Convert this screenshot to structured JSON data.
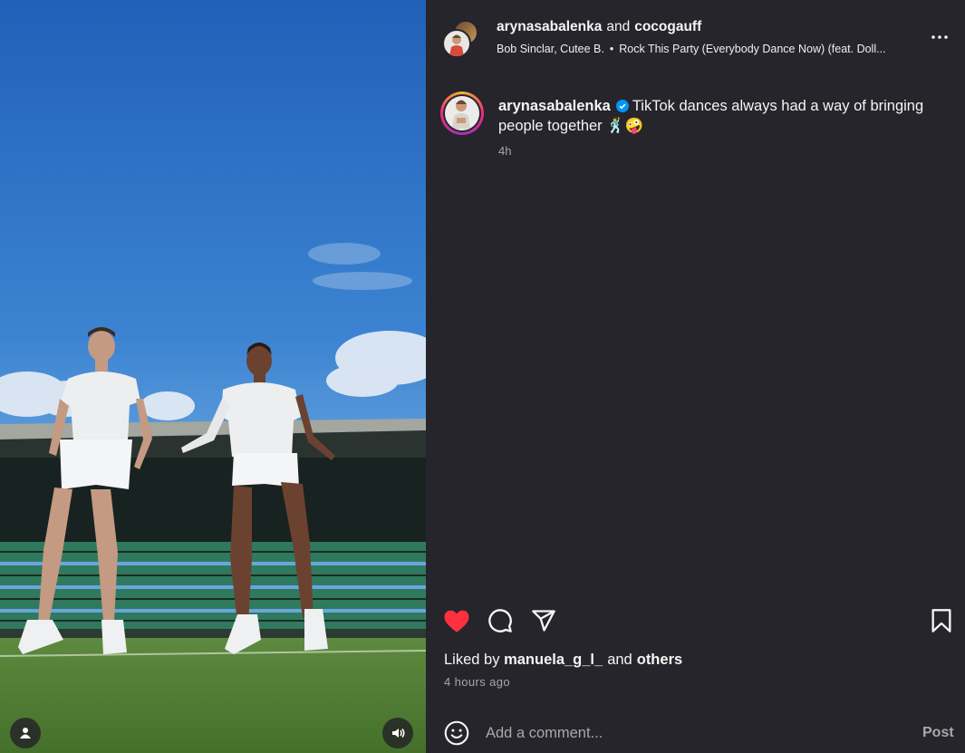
{
  "header": {
    "user_1": "arynasabalenka",
    "conjunction": "and",
    "user_2": "cocogauff",
    "audio_artist": "Bob Sinclar, Cutee B.",
    "audio_separator": "•",
    "audio_title": "Rock This Party (Everybody Dance Now) (feat. Doll..."
  },
  "caption": {
    "username": "arynasabalenka",
    "text": "TikTok dances always had a way of bringing people together 🕺🤪",
    "time": "4h"
  },
  "likes": {
    "prefix": "Liked by",
    "user": "manuela_g_l_",
    "mid": "and",
    "others": "others"
  },
  "post_time": "4 hours ago",
  "comment": {
    "placeholder": "Add a comment...",
    "post_label": "Post"
  },
  "colors": {
    "panel_bg": "#25252b",
    "like_red": "#ff3040",
    "verified_blue": "#0095f6",
    "muted_text": "#a8a8a8"
  },
  "icons": {
    "more": "more-horizontal-icon",
    "like": "heart-filled-icon",
    "comment": "comment-bubble-icon",
    "share": "paper-plane-icon",
    "save": "bookmark-icon",
    "emoji": "smiley-icon",
    "user_tag": "user-tag-icon",
    "audio": "speaker-icon"
  }
}
